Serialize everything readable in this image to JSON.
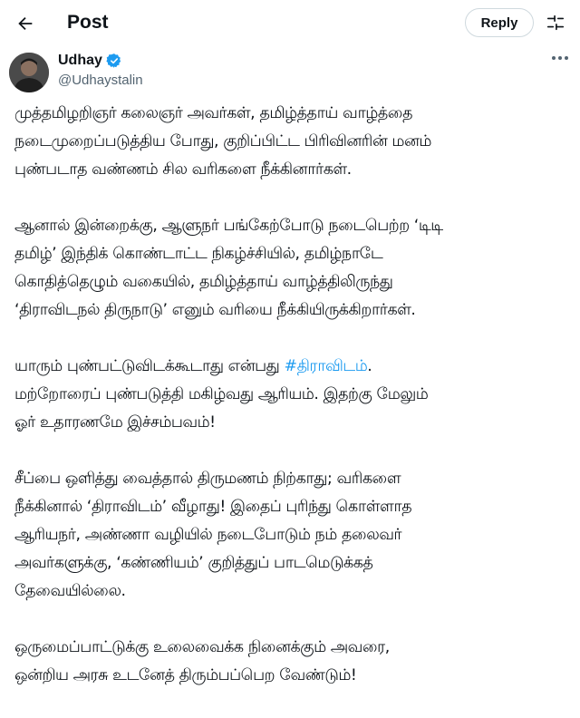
{
  "header": {
    "title": "Post",
    "reply_label": "Reply"
  },
  "author": {
    "name": "Udhay",
    "handle": "@Udhaystalin",
    "verified": true
  },
  "colors": {
    "accent": "#1d9bf0",
    "text": "#0f1419",
    "muted": "#536471"
  },
  "tweet": {
    "p1": [
      "முத்தமிழறிஞர் கலைஞர் அவர்கள், தமிழ்த்தாய் வாழ்த்தை",
      "நடைமுறைப்படுத்திய போது, குறிப்பிட்ட பிரிவினரின் மனம்",
      "புண்படாத வண்ணம் சில வரிகளை நீக்கினார்கள்."
    ],
    "p2": [
      "ஆனால் இன்றைக்கு, ஆளுநர் பங்கேற்போடு நடைபெற்ற ‘டிடி",
      "தமிழ்’ இந்திக் கொண்டாட்ட நிகழ்ச்சியில், தமிழ்நாடே",
      "கொதித்தெழும் வகையில், தமிழ்த்தாய் வாழ்த்திலிருந்து",
      "‘திராவிடநல் திருநாடு’ எனும் வரியை நீக்கியிருக்கிறார்கள்."
    ],
    "p3": {
      "line1_prefix": "யாரும் புண்பட்டுவிடக்கூடாது என்பது ",
      "hashtag": "#திராவிடம்",
      "line1_suffix": ".",
      "line2": "மற்றோரைப் புண்படுத்தி மகிழ்வது ஆரியம். இதற்கு மேலும்",
      "line3": "ஓர் உதாரணமே இச்சம்பவம்!"
    },
    "p4": [
      "சீப்பை ஒளித்து வைத்தால் திருமணம் நிற்காது; வரிகளை",
      "நீக்கினால் ‘திராவிடம்’ வீழாது! இதைப் புரிந்து கொள்ளாத",
      "ஆரியநர், அண்ணா வழியில் நடைபோடும் நம் தலைவர்",
      "அவர்களுக்கு, ‘கண்ணியம்’ குறித்துப் பாடமெடுக்கத்",
      "தேவையில்லை."
    ],
    "p5": [
      "ஒருமைப்பாட்டுக்கு உலைவைக்க நினைக்கும் அவரை,",
      "ஒன்றிய அரசு உடனேத் திரும்பப்பெற வேண்டும்!"
    ]
  }
}
